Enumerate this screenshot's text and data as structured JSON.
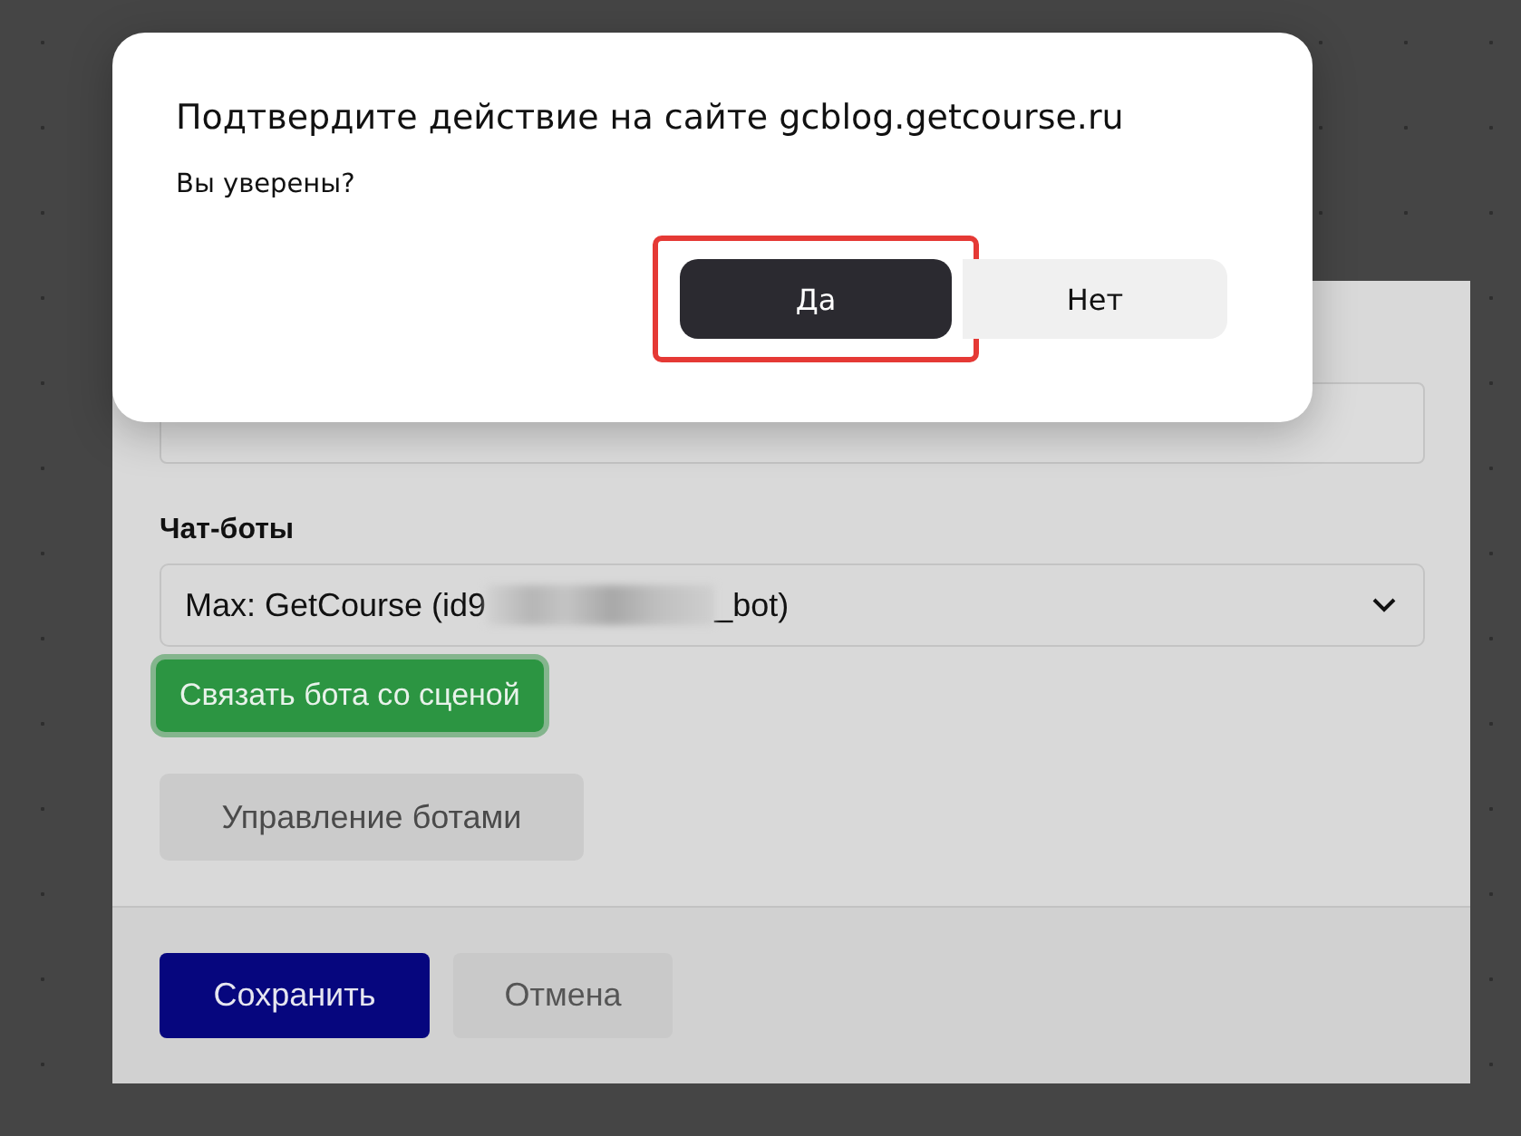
{
  "form": {
    "bots_label": "Чат-боты",
    "bot_select": {
      "value_start": "Max: GetCourse (id9",
      "value_end": "_bot)",
      "redacted": true
    },
    "link_button": {
      "label": "Связать бота со сценой",
      "focused": true
    },
    "manage_button": "Управление ботами",
    "buttons": [
      {
        "label": "Сохранить",
        "kind": "primary"
      },
      {
        "label": "Отмена",
        "kind": "secondary"
      }
    ]
  },
  "dialog": {
    "title": "Подтвердите действие на сайте gcblog.getcourse.ru",
    "message": "Вы уверены?",
    "buttons": [
      {
        "label": "Да",
        "kind": "primary",
        "highlighted": true
      },
      {
        "label": "Нет",
        "kind": "secondary",
        "highlighted": false
      }
    ]
  }
}
